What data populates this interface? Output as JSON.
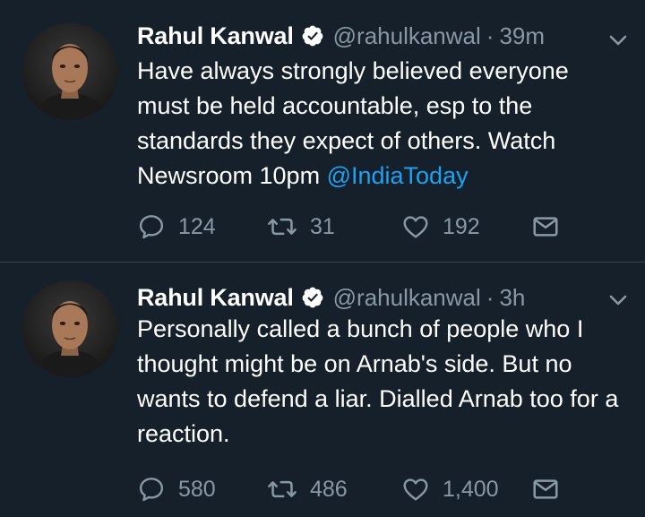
{
  "colors": {
    "background": "#15202b",
    "divider": "#38444d",
    "text_primary": "#ffffff",
    "text_secondary": "#8899a6",
    "link": "#1da1f2"
  },
  "tweets": [
    {
      "author_name": "Rahul Kanwal",
      "handle": "@rahulkanwal",
      "separator": "·",
      "time": "39m",
      "text_before_mention": "Have always strongly believed everyone must be held accountable, esp to the standards they expect of others. Watch Newsroom 10pm ",
      "mention": "@IndiaToday",
      "reply_count": "124",
      "retweet_count": "31",
      "like_count": "192",
      "verified_icon": "verified-badge-icon",
      "avatar": "profile-photo"
    },
    {
      "author_name": "Rahul Kanwal",
      "handle": "@rahulkanwal",
      "separator": "·",
      "time": "3h",
      "text_before_mention": "Personally called a bunch of people who I thought might be on Arnab's side. But no wants to defend a liar. Dialled Arnab too for a reaction.",
      "mention": "",
      "reply_count": "580",
      "retweet_count": "486",
      "like_count": "1,400",
      "verified_icon": "verified-badge-icon",
      "avatar": "profile-photo"
    }
  ]
}
